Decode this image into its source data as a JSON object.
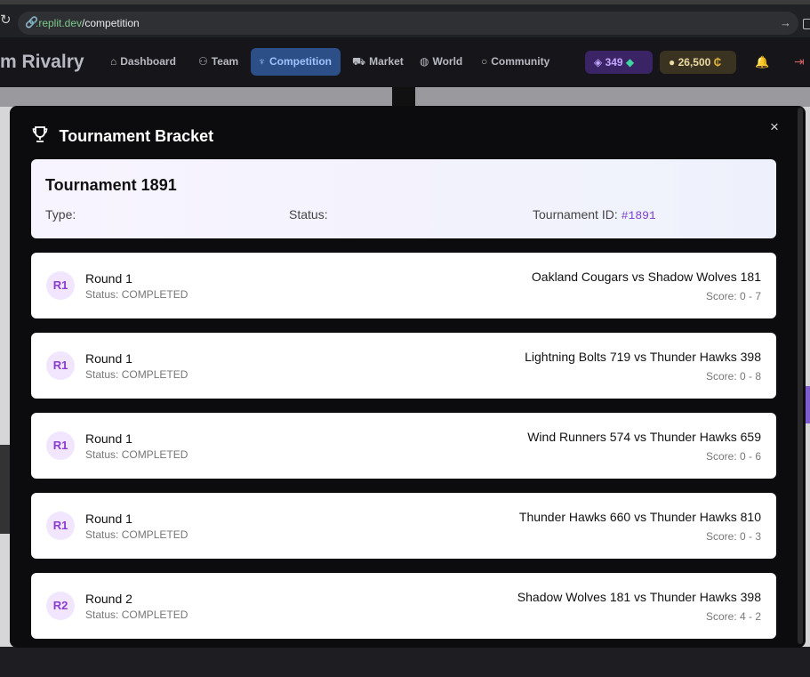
{
  "browser": {
    "url_domain": ".replit.dev",
    "url_path": "/competition"
  },
  "app": {
    "brand": "m Rivalry",
    "nav": [
      {
        "label": "Dashboard",
        "icon": "home-icon"
      },
      {
        "label": "Team",
        "icon": "users-icon"
      },
      {
        "label": "Competition",
        "icon": "trophy-icon",
        "active": true
      },
      {
        "label": "Market",
        "icon": "cart-icon"
      },
      {
        "label": "World",
        "icon": "globe-icon"
      },
      {
        "label": "Community",
        "icon": "chat-icon"
      }
    ],
    "gems": "349",
    "coins": "26,500"
  },
  "modal": {
    "title": "Tournament Bracket",
    "close_symbol": "×",
    "tournament": {
      "name": "Tournament 1891",
      "type_label": "Type:",
      "status_label": "Status:",
      "id_label": "Tournament ID:",
      "id_value": "#1891"
    },
    "matches": [
      {
        "badge": "R1",
        "round": "Round 1",
        "status": "Status: COMPLETED",
        "teams": "Oakland Cougars vs Shadow Wolves 181",
        "score": "Score: 0 - 7"
      },
      {
        "badge": "R1",
        "round": "Round 1",
        "status": "Status: COMPLETED",
        "teams": "Lightning Bolts 719 vs Thunder Hawks 398",
        "score": "Score: 0 - 8"
      },
      {
        "badge": "R1",
        "round": "Round 1",
        "status": "Status: COMPLETED",
        "teams": "Wind Runners 574 vs Thunder Hawks 659",
        "score": "Score: 0 - 6"
      },
      {
        "badge": "R1",
        "round": "Round 1",
        "status": "Status: COMPLETED",
        "teams": "Thunder Hawks 660 vs Thunder Hawks 810",
        "score": "Score: 0 - 3"
      },
      {
        "badge": "R2",
        "round": "Round 2",
        "status": "Status: COMPLETED",
        "teams": "Shadow Wolves 181 vs Thunder Hawks 398",
        "score": "Score: 4 - 2"
      }
    ]
  }
}
